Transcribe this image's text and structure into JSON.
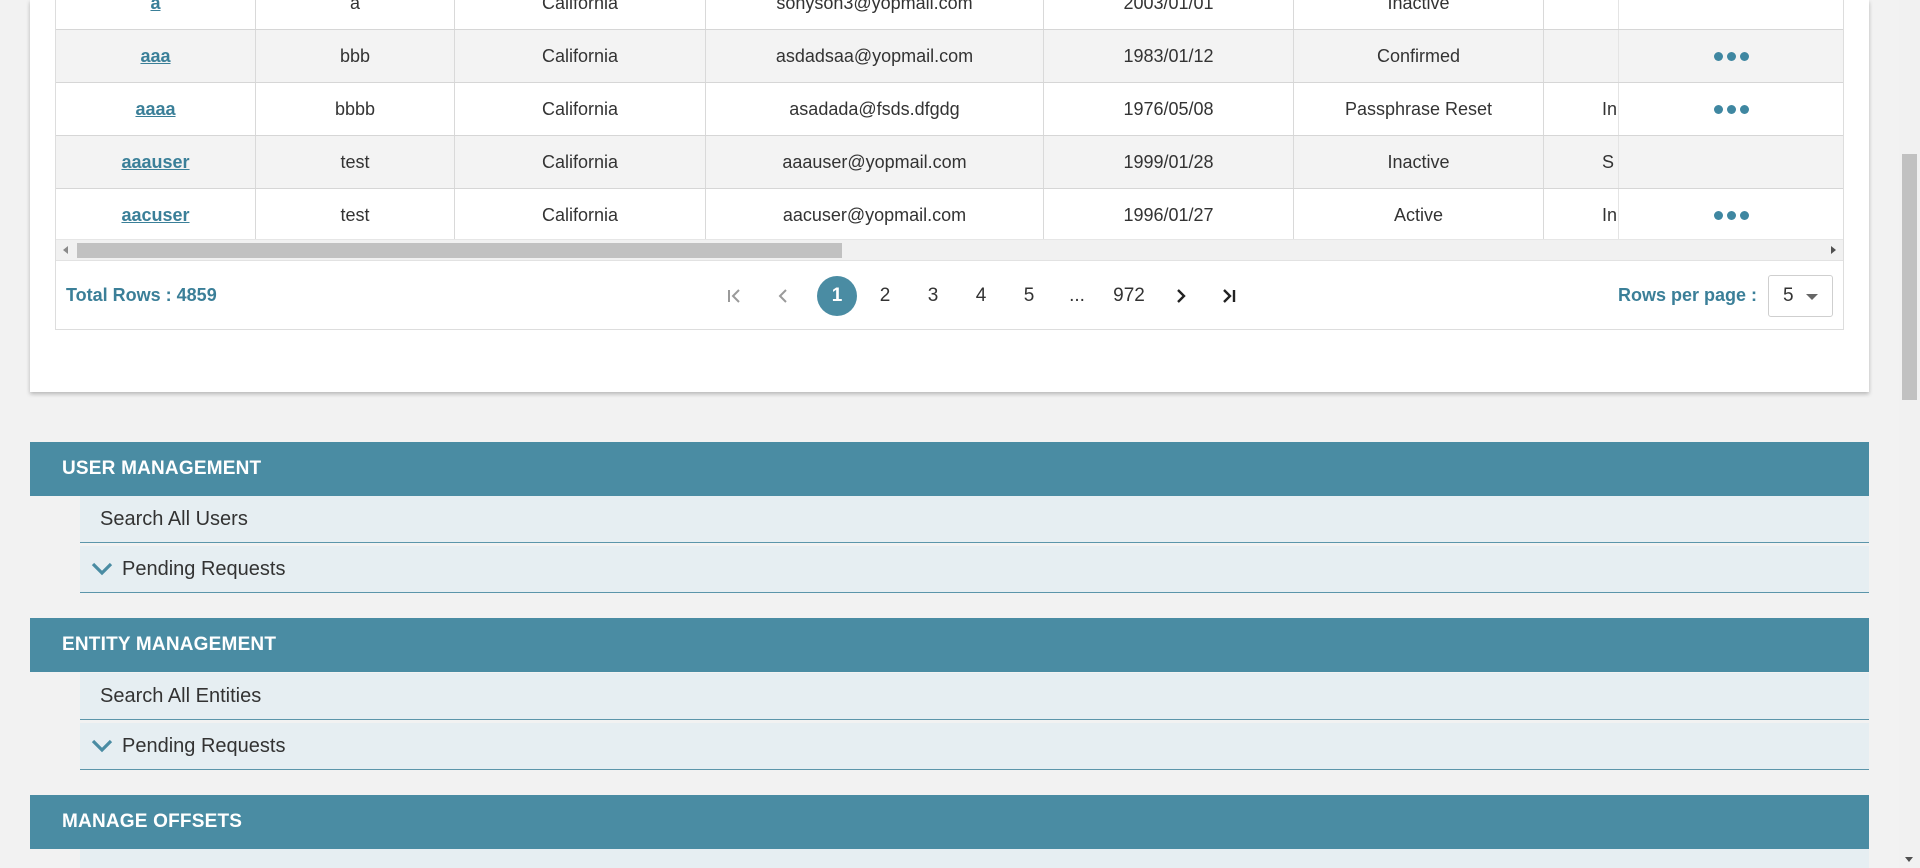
{
  "table": {
    "rows": [
      {
        "username": "a",
        "col2": "a",
        "state": "California",
        "email": "sonyson3@yopmail.com",
        "dob": "2003/01/01",
        "status": "Inactive",
        "partial": "",
        "has_actions": false
      },
      {
        "username": "aaa",
        "col2": "bbb",
        "state": "California",
        "email": "asdadsaa@yopmail.com",
        "dob": "1983/01/12",
        "status": "Confirmed",
        "partial": "",
        "has_actions": true
      },
      {
        "username": "aaaa",
        "col2": "bbbb",
        "state": "California",
        "email": "asadada@fsds.dfgdg",
        "dob": "1976/05/08",
        "status": "Passphrase Reset",
        "partial": "In",
        "has_actions": true
      },
      {
        "username": "aaauser",
        "col2": "test",
        "state": "California",
        "email": "aaauser@yopmail.com",
        "dob": "1999/01/28",
        "status": "Inactive",
        "partial": "S",
        "has_actions": false
      },
      {
        "username": "aacuser",
        "col2": "test",
        "state": "California",
        "email": "aacuser@yopmail.com",
        "dob": "1996/01/27",
        "status": "Active",
        "partial": "In",
        "has_actions": true
      }
    ]
  },
  "pager": {
    "total_rows": "Total Rows : 4859",
    "pages": [
      "1",
      "2",
      "3",
      "4",
      "5",
      "...",
      "972"
    ],
    "active_page": "1",
    "rows_per_page_label": "Rows per page :",
    "rows_per_page_value": "5"
  },
  "sections": {
    "user_management": {
      "title": "USER MANAGEMENT",
      "search": "Search All Users",
      "pending": "Pending Requests"
    },
    "entity_management": {
      "title": "ENTITY MANAGEMENT",
      "search": "Search All Entities",
      "pending": "Pending Requests"
    },
    "manage_offsets": {
      "title": "MANAGE OFFSETS"
    }
  },
  "colors": {
    "accent": "#4a8ca3",
    "link": "#3a7f98",
    "sub_bg": "#e6eef2"
  },
  "icons": {
    "first": "first-page-icon",
    "prev": "prev-page-icon",
    "next": "next-page-icon",
    "last": "last-page-icon",
    "actions": "more-actions-icon",
    "chevron": "chevron-down-icon"
  }
}
